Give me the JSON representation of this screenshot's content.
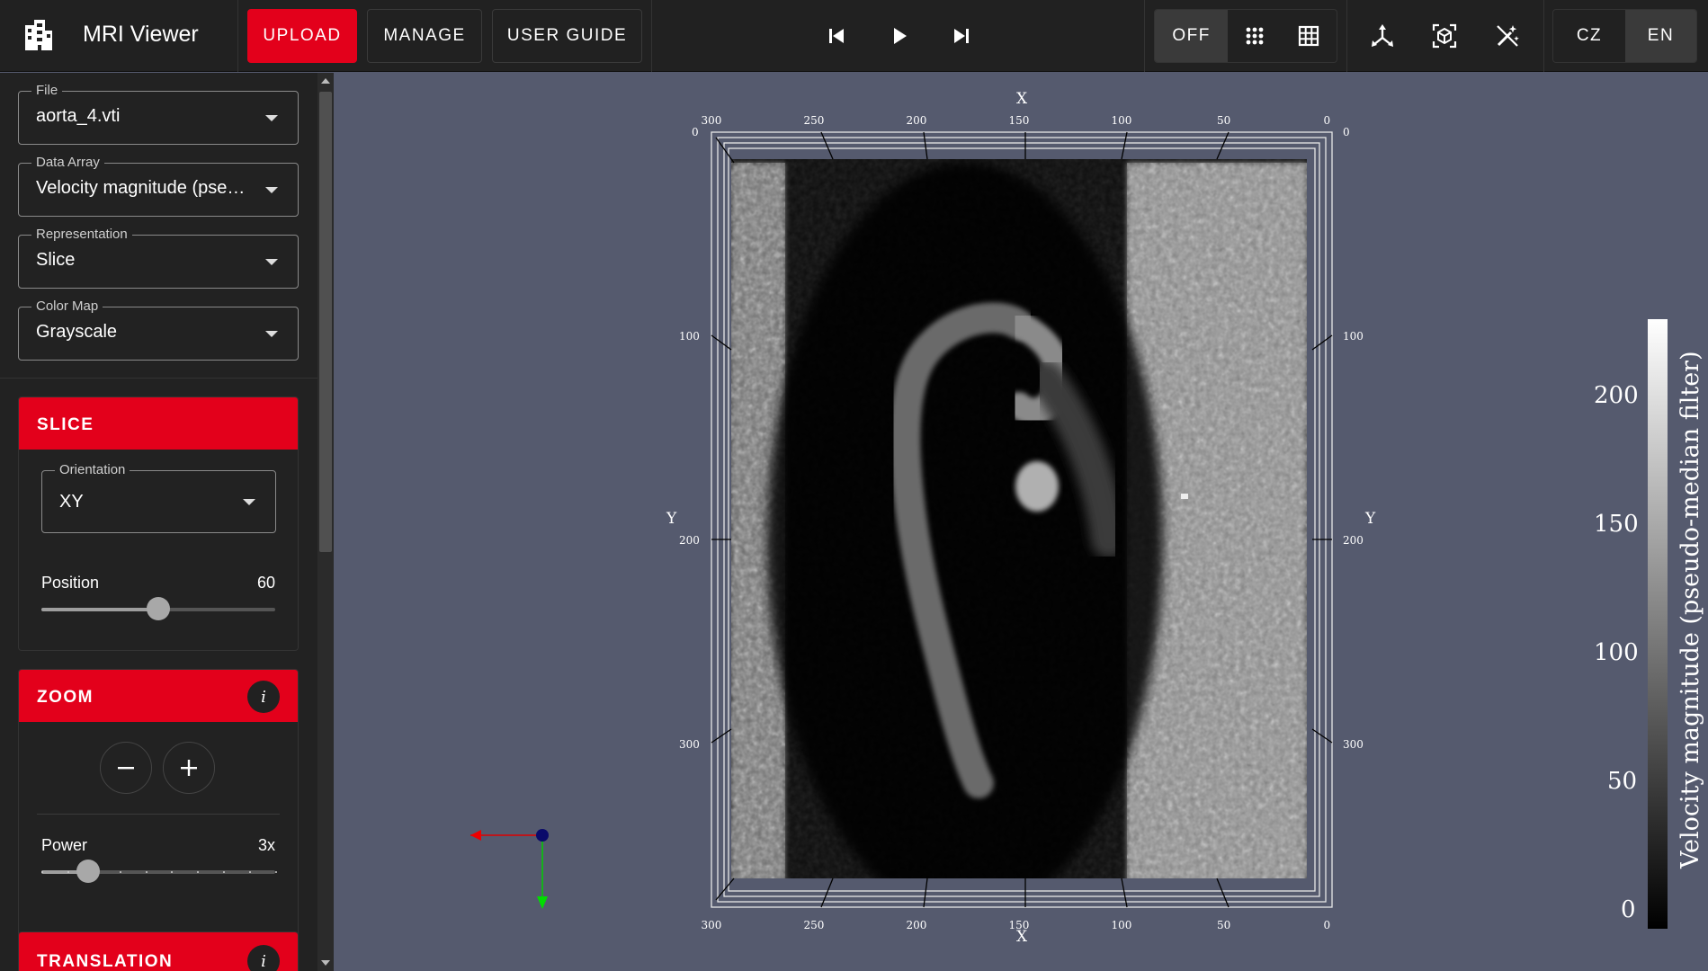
{
  "app": {
    "title": "MRI Viewer"
  },
  "nav": {
    "upload": "UPLOAD",
    "manage": "MANAGE",
    "user_guide": "USER GUIDE"
  },
  "grid_toggle": {
    "off": "OFF",
    "selected": "OFF"
  },
  "language": {
    "cz": "CZ",
    "en": "EN",
    "selected": "EN"
  },
  "controls": {
    "file": {
      "label": "File",
      "value": "aorta_4.vti"
    },
    "data_array": {
      "label": "Data Array",
      "value": "Velocity magnitude (pseudo-median filter)"
    },
    "representation": {
      "label": "Representation",
      "value": "Slice"
    },
    "color_map": {
      "label": "Color Map",
      "value": "Grayscale"
    }
  },
  "slice_panel": {
    "title": "SLICE",
    "orientation": {
      "label": "Orientation",
      "value": "XY"
    },
    "position": {
      "label": "Position",
      "value": "60",
      "fraction": 0.5
    }
  },
  "zoom_panel": {
    "title": "ZOOM",
    "info": "i",
    "power": {
      "label": "Power",
      "value": "3x",
      "fraction": 0.2
    }
  },
  "translation_panel": {
    "title": "TRANSLATION",
    "info": "i"
  },
  "viewport": {
    "x_ticks": [
      "300",
      "250",
      "200",
      "150",
      "100",
      "50",
      "0"
    ],
    "y_ticks": [
      "0",
      "100",
      "200",
      "300"
    ],
    "x_title": "X",
    "y_title": "Y",
    "colorbar": {
      "title": "Velocity magnitude (pseudo-median filter)",
      "ticks": [
        "200",
        "150",
        "100",
        "50",
        "0"
      ]
    }
  },
  "icons": {
    "logo": "building-icon",
    "prev": "skip-previous-icon",
    "play": "play-icon",
    "next": "skip-next-icon",
    "grid_dots": "dots-grid-icon",
    "grid_lines": "grid-icon",
    "axes": "axis-arrow-icon",
    "cube": "cube-focus-icon",
    "wand": "magic-wand-off-icon"
  },
  "colors": {
    "accent": "#e3001b",
    "topbar": "#212121",
    "sidebar": "#222222",
    "viewport_bg": "#555a6e"
  }
}
